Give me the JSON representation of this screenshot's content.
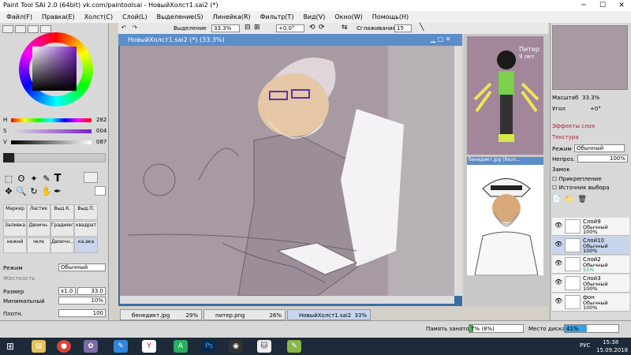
{
  "window": {
    "title": "Paint Tool SAI 2.0 (64bit) vk.com/paintoolsai - НовыйХолст1.sai2 (*)"
  },
  "menu": [
    "Файл(F)",
    "Правка(E)",
    "Холст(C)",
    "Слой(L)",
    "Выделение(S)",
    "Линейка(R)",
    "Фильтр(T)",
    "Вид(V)",
    "Окно(W)",
    "Помощь(H)"
  ],
  "toolbar": {
    "selection_label": "Выделение",
    "zoom": "33.3%",
    "rotation": "+0.0°",
    "smoothing_label": "Сглаживание",
    "smoothing_value": "15"
  },
  "color": {
    "h_label": "H",
    "h_value": "282",
    "s_label": "S",
    "s_value": "004",
    "v_label": "V",
    "v_value": "087",
    "accent": "#7a21c4"
  },
  "brushes": [
    {
      "label": "Маркер",
      "sel": false
    },
    {
      "label": "Ластик",
      "sel": false
    },
    {
      "label": "Выд.К.",
      "sel": false
    },
    {
      "label": "Выд.П.",
      "sel": false
    },
    {
      "label": "Заливка",
      "sel": false
    },
    {
      "label": "Двоичн.",
      "sel": false
    },
    {
      "label": "Градиент",
      "sel": false
    },
    {
      "label": "квадрат",
      "sel": false
    },
    {
      "label": "нежнй",
      "sel": false
    },
    {
      "label": "челк",
      "sel": false
    },
    {
      "label": "Двоичн...",
      "sel": false
    },
    {
      "label": "ка.ака",
      "sel": true
    }
  ],
  "brush_panel": {
    "mode_label": "Режим",
    "mode_value": "Обычный",
    "hardness_label": "Жесткость",
    "size_label": "Размер",
    "size_mult": "x1.0",
    "size_value": "33.0",
    "min_label": "Минимальный",
    "min_value": "10%",
    "density_label": "Плотн.",
    "density_value": "100"
  },
  "canvas": {
    "title": "НовыйХолст1.sai2 (*) (33.3%)"
  },
  "reference": {
    "title_small": "Питер",
    "subtitle_small": "9 лет",
    "second_title": "бенедикт.jpg (безп..."
  },
  "tabs": [
    {
      "name": "бенедикт.jpg",
      "pct": "29%"
    },
    {
      "name": "питер.png",
      "pct": "26%"
    },
    {
      "name": "НовыйХолст1.sai2",
      "pct": "33%"
    }
  ],
  "navigator": {
    "zoom_label": "Масштаб",
    "zoom_value": "33.3%",
    "angle_label": "Угол",
    "angle_value": "+0°"
  },
  "layer_panel": {
    "effects_label": "Эффекты слоя",
    "texture_label": "Текстура",
    "mode_label": "Режим",
    "mode_value": "Обычный",
    "opacity_label": "Непроз.",
    "opacity_value": "100%",
    "lock_label": "Замок",
    "clip_label": "Прикрепление",
    "source_label": "Источник выбора"
  },
  "layers": [
    {
      "name": "Слой9",
      "mode": "Обычный",
      "opacity": "100%",
      "sel": false
    },
    {
      "name": "Слой10",
      "mode": "Обычный",
      "opacity": "100%",
      "sel": true
    },
    {
      "name": "Слой2",
      "mode": "Обычный",
      "opacity": "55%",
      "sel": false
    },
    {
      "name": "Слой3",
      "mode": "Обычный",
      "opacity": "100%",
      "sel": false
    },
    {
      "name": "фон",
      "mode": "Обычный",
      "opacity": "100%",
      "sel": false
    }
  ],
  "status": {
    "memory_label": "Память занято",
    "memory_value": "7% (8%)",
    "disk_label": "Место диска",
    "disk_value": "41%",
    "memory_fill": 0.07,
    "disk_fill": 0.41
  },
  "taskbar": {
    "lang": "РУС",
    "time": "15:38",
    "date": "15.09.2018"
  }
}
